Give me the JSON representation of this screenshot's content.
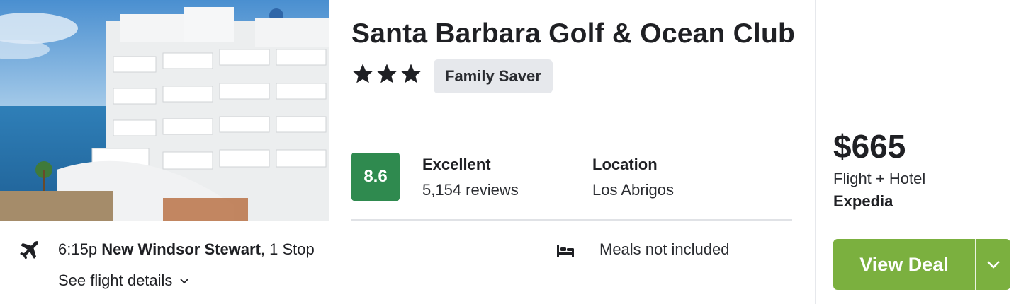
{
  "hotel": {
    "name": "Santa Barbara Golf & Ocean Club",
    "star_rating": 3,
    "badge": "Family Saver",
    "score": "8.6",
    "rating_label": "Excellent",
    "reviews": "5,154 reviews",
    "location_label": "Location",
    "location": "Los Abrigos",
    "meals": "Meals not included",
    "image_icon": "hotel-photo"
  },
  "flight": {
    "time": "6:15p",
    "origin": "New Windsor Stewart",
    "stops": ", 1 Stop",
    "details_link": "See flight details",
    "icon": "plane-icon"
  },
  "price": {
    "amount": "$665",
    "package": "Flight + Hotel",
    "provider": "Expedia"
  },
  "cta": {
    "label": "View Deal"
  },
  "colors": {
    "score_bg": "#2f8a4f",
    "cta_bg": "#7bb03f",
    "badge_bg": "#e6e8ec"
  }
}
